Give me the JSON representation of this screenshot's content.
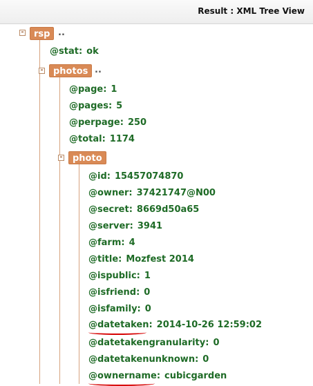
{
  "header": {
    "title": "Result : XML Tree View"
  },
  "rsp": {
    "tag": "rsp",
    "ellipsis": "..",
    "stat": {
      "key": "@stat:",
      "value": "ok"
    }
  },
  "photos": {
    "tag": "photos",
    "ellipsis": "..",
    "page": {
      "key": "@page:",
      "value": "1"
    },
    "pages": {
      "key": "@pages:",
      "value": "5"
    },
    "perpage": {
      "key": "@perpage:",
      "value": "250"
    },
    "total": {
      "key": "@total:",
      "value": "1174"
    }
  },
  "photo": {
    "tag": "photo",
    "id": {
      "key": "@id:",
      "value": "15457074870"
    },
    "owner": {
      "key": "@owner:",
      "value": "37421747@N00"
    },
    "secret": {
      "key": "@secret:",
      "value": "8669d50a65"
    },
    "server": {
      "key": "@server:",
      "value": "3941"
    },
    "farm": {
      "key": "@farm:",
      "value": "4"
    },
    "title": {
      "key": "@title:",
      "value": "Mozfest 2014"
    },
    "ispublic": {
      "key": "@ispublic:",
      "value": "1"
    },
    "isfriend": {
      "key": "@isfriend:",
      "value": "0"
    },
    "isfamily": {
      "key": "@isfamily:",
      "value": "0"
    },
    "datetaken": {
      "key": "@datetaken:",
      "value": "2014-10-26 12:59:02"
    },
    "datetakengranularity": {
      "key": "@datetakengranularity:",
      "value": "0"
    },
    "datetakenunknown": {
      "key": "@datetakenunknown:",
      "value": "0"
    },
    "ownername": {
      "key": "@ownername:",
      "value": "cubicgarden"
    }
  },
  "icons": {
    "collapse": "minus-box"
  },
  "colors": {
    "tag_bg": "#d98a56",
    "attr_text": "#1e6b26",
    "annotation": "#d60000"
  }
}
